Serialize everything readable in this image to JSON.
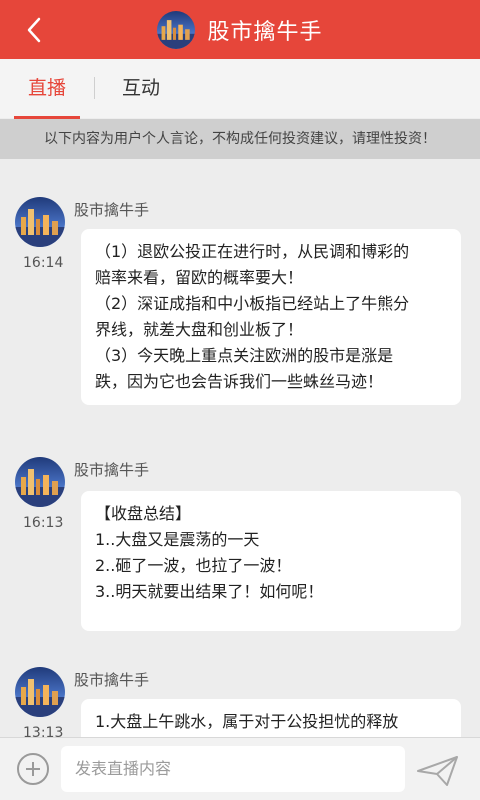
{
  "header": {
    "title": "股市擒牛手",
    "icons": {
      "back": "chevron-left-icon",
      "avatar": "avatar"
    },
    "colors": {
      "bar": "#e6463a",
      "text": "#ffffff"
    }
  },
  "tabs": [
    {
      "label": "直播",
      "active": true
    },
    {
      "label": "互动",
      "active": false
    }
  ],
  "notice": {
    "text": "以下内容为用户个人言论，不构成任何投资建议，请理性投资！"
  },
  "messages": [
    {
      "author": "股市擒牛手",
      "time": "16:14",
      "lines": [
        "（1）退欧公投正在进行时，从民调和博彩的",
        "赔率来看，留欧的概率要大！",
        "（2）深证成指和中小板指已经站上了牛熊分",
        "界线，就差大盘和创业板了！",
        "（3）今天晚上重点关注欧洲的股市是涨是",
        "跌，因为它也会告诉我们一些蛛丝马迹！"
      ]
    },
    {
      "author": "股市擒牛手",
      "time": "16:13",
      "lines": [
        "【收盘总结】",
        "1..大盘又是震荡的一天",
        "2..砸了一波，也拉了一波！",
        "3..明天就要出结果了！如何呢！"
      ]
    },
    {
      "author": "股市擒牛手",
      "time": "13:13",
      "lines": [
        "1.大盘上午跳水，属于对于公投担忧的释放"
      ]
    }
  ],
  "composer": {
    "placeholder": "发表直播内容",
    "icons": {
      "add": "plus-circle-icon",
      "send": "send-icon"
    }
  }
}
